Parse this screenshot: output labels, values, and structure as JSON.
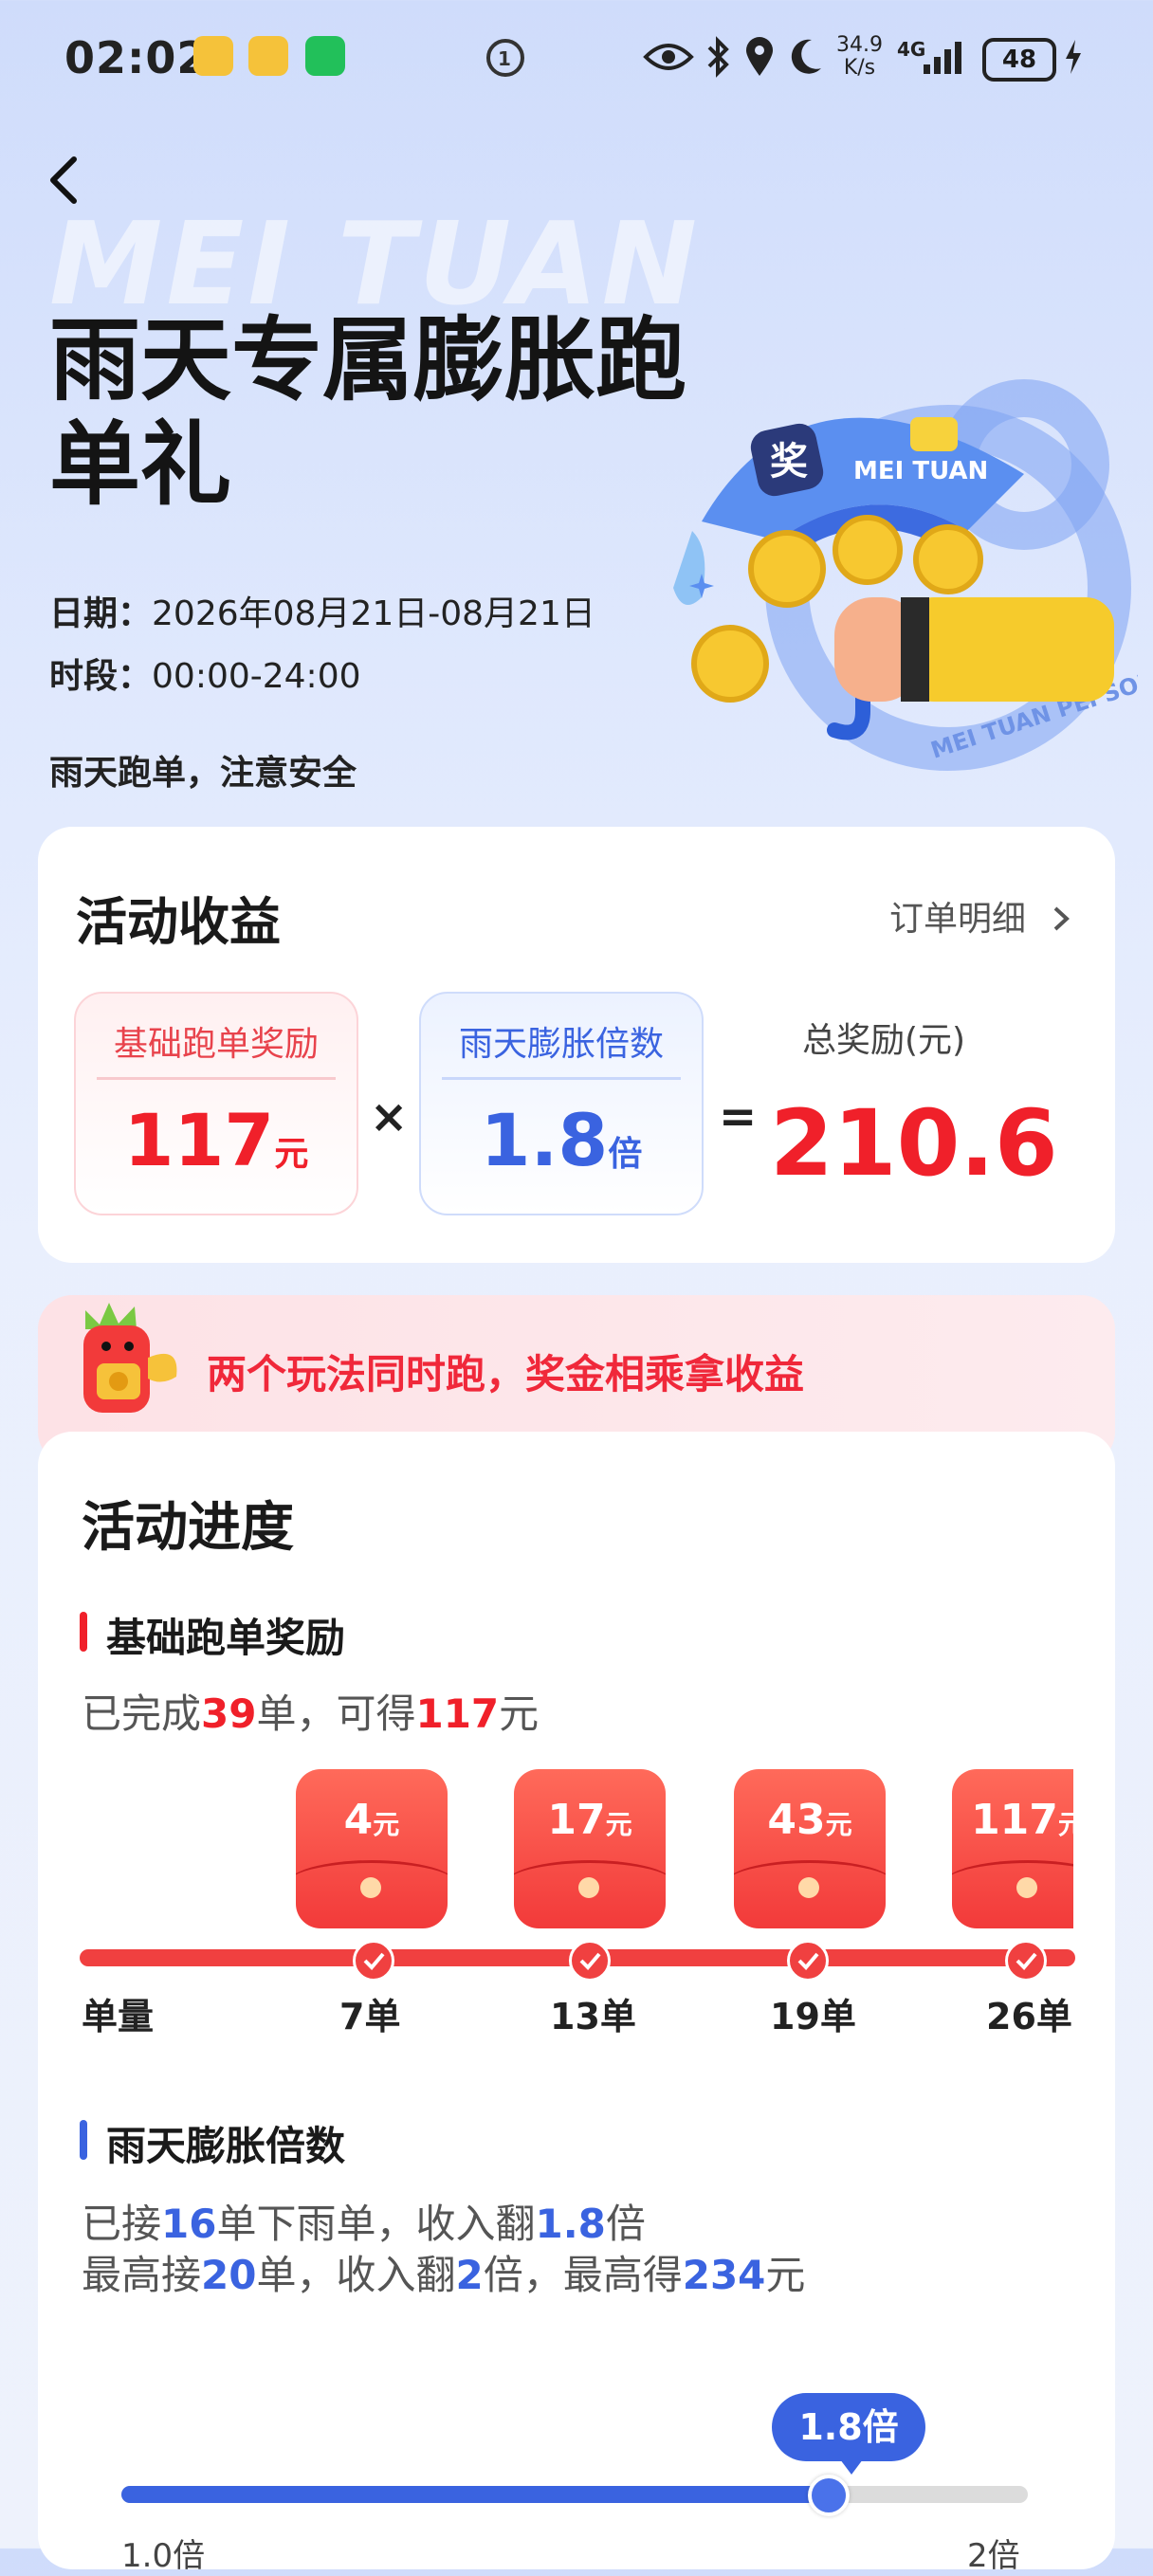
{
  "status_bar": {
    "time": "02:02",
    "speed": "34.9",
    "speed_unit": "K/s",
    "net": "4G",
    "battery": "48"
  },
  "hero": {
    "watermark": "MEI TUAN",
    "title": "雨天专属膨胀跑单礼",
    "date_label": "日期：",
    "date_value": "2026年08月21日-08月21日",
    "period_label": "时段：",
    "period_value": "00:00-24:00",
    "tip": "雨天跑单，注意安全",
    "umbrella_text": "MEI TUAN",
    "umbrella_badge": "奖",
    "ring_text": "MEI TUAN PEI SONG"
  },
  "earnings": {
    "title": "活动收益",
    "detail_link": "订单明细",
    "base_label": "基础跑单奖励",
    "base_value": "117",
    "base_unit": "元",
    "multiply": "×",
    "mult_label": "雨天膨胀倍数",
    "mult_value": "1.8",
    "mult_unit": "倍",
    "equals": "=",
    "total_label": "总奖励(元)",
    "total_value": "210.6"
  },
  "banner": {
    "text": "两个玩法同时跑，奖金相乘拿收益"
  },
  "progress": {
    "title": "活动进度",
    "base_section": {
      "title": "基础跑单奖励",
      "desc_pre": "已完成",
      "desc_orders": "39",
      "desc_mid": "单，可得",
      "desc_amount": "117",
      "desc_post": "元",
      "axis_label": "单量",
      "milestones": [
        {
          "amount": "4",
          "unit": "元",
          "orders": "7单"
        },
        {
          "amount": "17",
          "unit": "元",
          "orders": "13单"
        },
        {
          "amount": "43",
          "unit": "元",
          "orders": "19单"
        },
        {
          "amount": "117",
          "unit": "元",
          "orders": "26单"
        }
      ]
    },
    "rain_section": {
      "title": "雨天膨胀倍数",
      "line1_pre": "已接",
      "line1_orders": "16",
      "line1_mid": "单下雨单，收入翻",
      "line1_mult": "1.8",
      "line1_post": "倍",
      "line2_pre": "最高接",
      "line2_orders": "20",
      "line2_mid": "单，收入翻",
      "line2_mult": "2",
      "line2_mid2": "倍，最高得",
      "line2_amount": "234",
      "line2_post": "元",
      "slider_value": "1.8倍",
      "slider_fraction": 0.78,
      "slider_min_label": "1.0倍",
      "slider_max_label": "2倍"
    }
  },
  "colors": {
    "accent_red": "#f0202a",
    "accent_blue": "#3a63e0"
  }
}
